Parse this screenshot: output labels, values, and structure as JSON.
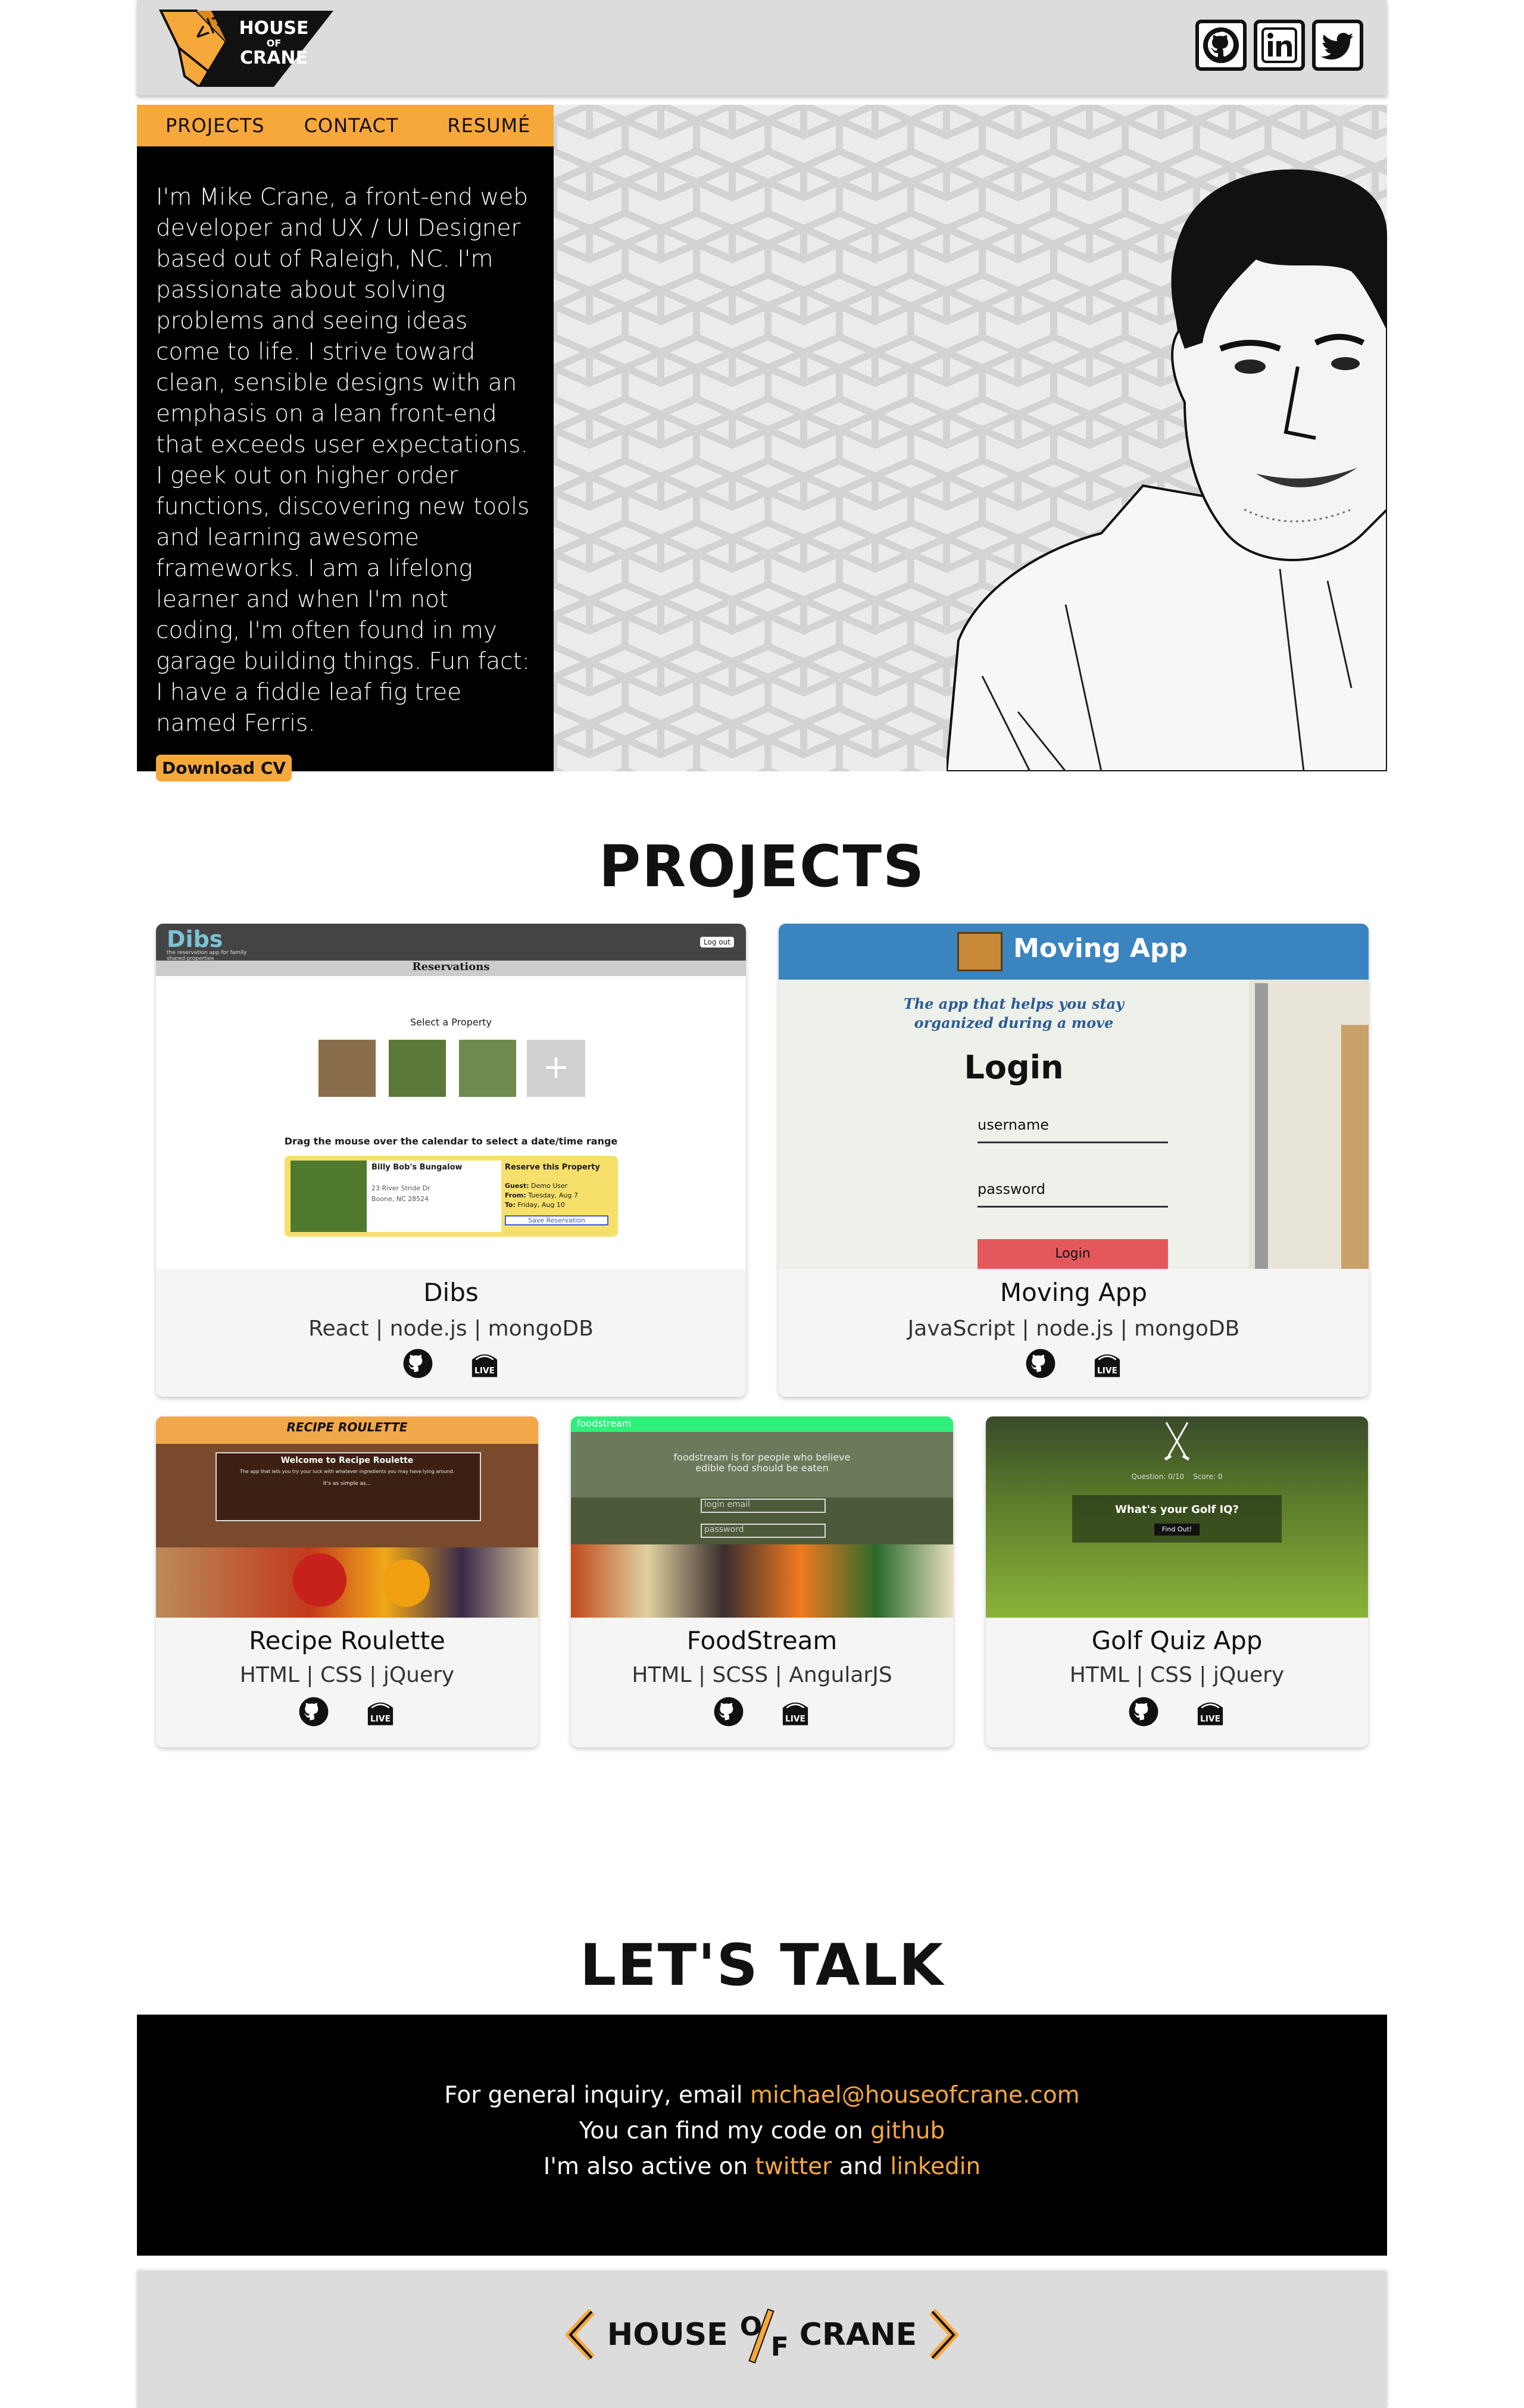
{
  "brand": {
    "logo_word_1": "HOUSE",
    "logo_word_of": "OF",
    "logo_word_2": "CRANE",
    "footer_house": "HOUSE",
    "footer_o": "O",
    "footer_f": "F",
    "footer_crane": "CRANE"
  },
  "social_icons": [
    "github-icon",
    "linkedin-icon",
    "twitter-icon"
  ],
  "nav": {
    "projects": "PROJECTS",
    "contact": "CONTACT",
    "resume": "RESUMÉ"
  },
  "intro": {
    "text": "I'm Mike Crane, a front-end web developer and UX / UI Designer based out of Raleigh, NC. I'm passionate about solving problems and seeing ideas come to life. I strive toward clean, sensible designs with an emphasis on a lean front-end that exceeds user expectations. I geek out on higher order functions, discovering new tools and learning awesome frameworks. I am a lifelong learner and when I'm not coding, I'm often found in my garage building things. Fun fact: I have a fiddle leaf fig tree named Ferris.",
    "cv_button": "Download CV"
  },
  "projects_title": "PROJECTS",
  "projects": [
    {
      "name": "Dibs",
      "tech": "React | node.js | mongoDB",
      "shot": {
        "logo": "Dibs",
        "tagline": "the reservation app for family shared properties",
        "logout": "Log out",
        "header": "Reservations",
        "select": "Select a Property",
        "add": "+",
        "drag": "Drag the mouse over the calendar to select a date/time range",
        "property_name": "Billy Bob's Bungalow",
        "address1": "23 River Stride Dr",
        "address2": "Boone, NC 28524",
        "reserve_title": "Reserve this Property",
        "guest_label": "Guest:",
        "guest": "Demo User",
        "from_label": "From:",
        "from": "Tuesday, Aug 7",
        "to_label": "To:",
        "to": "Friday, Aug 10",
        "save": "Save Reservation"
      }
    },
    {
      "name": "Moving App",
      "tech": "JavaScript | node.js | mongoDB",
      "shot": {
        "title": "Moving App",
        "tagline_1": "The app that helps you stay",
        "tagline_2": "organized during a move",
        "login_title": "Login",
        "username": "username",
        "password": "password",
        "login_btn": "Login"
      }
    },
    {
      "name": "Recipe Roulette",
      "tech": "HTML | CSS | jQuery",
      "shot": {
        "logo": "RECIPE ROULETTE",
        "welcome": "Welcome to Recipe Roulette",
        "blurb": "The app that lets you try your luck with whatever ingredients you may have lying around.",
        "simple": "It's as simple as..."
      }
    },
    {
      "name": "FoodStream",
      "tech": "HTML | SCSS | AngularJS",
      "shot": {
        "brand": "foodstream",
        "blurb": "foodstream is for people who believe edible food should be eaten",
        "login_email": "login email",
        "password": "password"
      }
    },
    {
      "name": "Golf Quiz App",
      "tech": "HTML | CSS | jQuery",
      "shot": {
        "question_label": "Question:",
        "question_value": "0/10",
        "score_label": "Score:",
        "score_value": "0",
        "prompt": "What's your Golf IQ?",
        "find_out": "Find Out!"
      }
    }
  ],
  "card_icons": {
    "repo": "github-icon",
    "live_label": "LIVE"
  },
  "talk_title": "LET'S TALK",
  "contact": {
    "line1_prefix": "For general inquiry, email ",
    "email": "michael@houseofcrane.com",
    "line2_prefix": "You can find my code on ",
    "github": "github",
    "line3_prefix": "I'm also active on ",
    "twitter": "twitter",
    "line3_and": " and ",
    "linkedin": "linkedin"
  },
  "colors": {
    "accent": "#f7a83b",
    "header_bg": "#dcdcdc",
    "dark": "#000000"
  }
}
